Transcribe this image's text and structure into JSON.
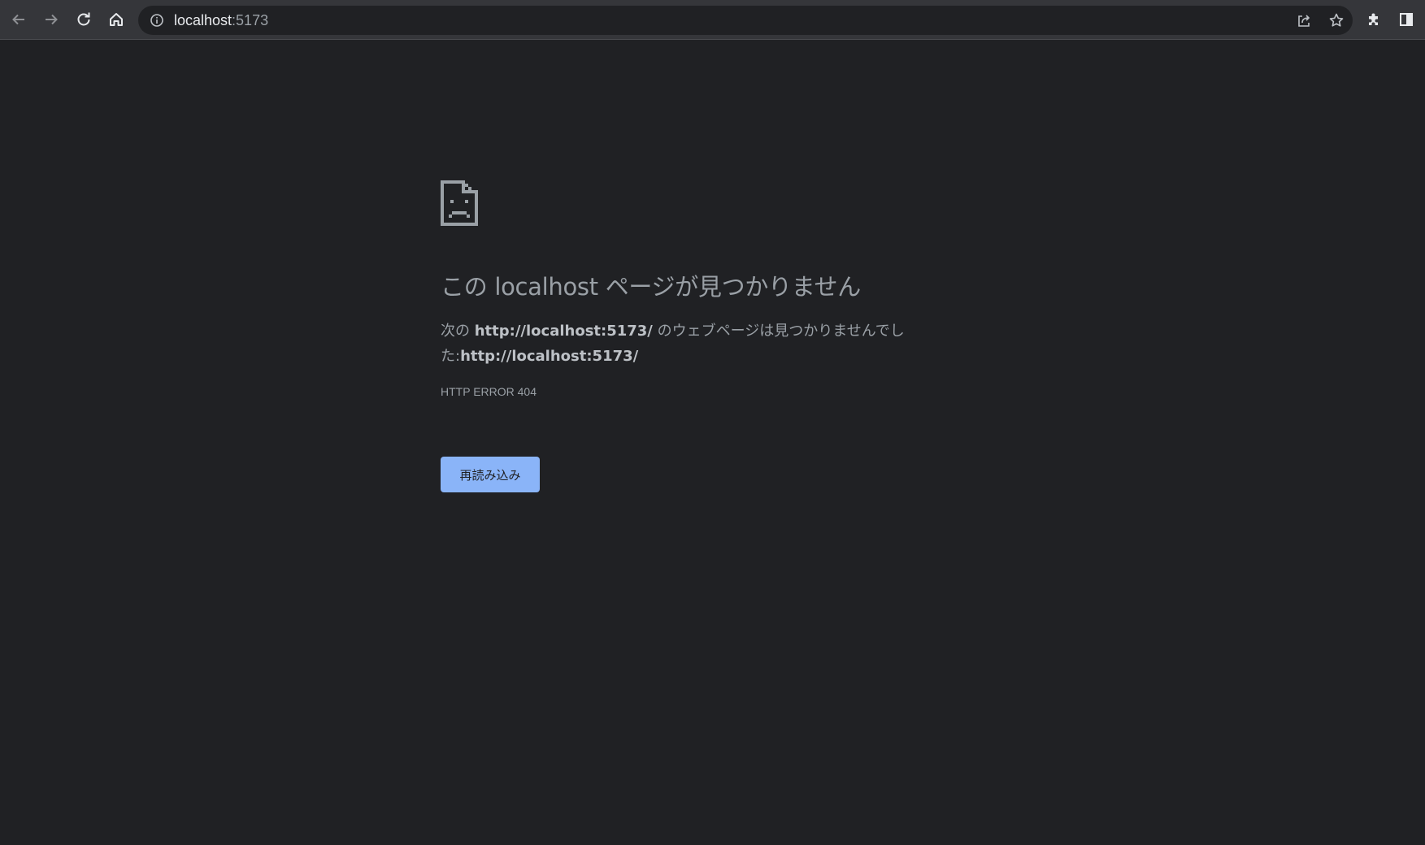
{
  "browser": {
    "url_host": "localhost",
    "url_port": ":5173",
    "back_icon": "arrow-left-icon",
    "forward_icon": "arrow-right-icon",
    "reload_icon": "reload-icon",
    "home_icon": "home-icon",
    "site_info_icon": "info-icon",
    "share_icon": "share-icon",
    "bookmark_icon": "star-icon",
    "extensions_icon": "puzzle-icon",
    "side_panel_icon": "side-panel-icon"
  },
  "error_page": {
    "icon": "sad-document-icon",
    "headline": "この localhost ページが見つかりません",
    "desc_prefix": "次の ",
    "desc_url": "http://localhost:5173/",
    "desc_middle": " のウェブページは見つかりませんでした:",
    "desc_url2": "http://localhost:5173/",
    "error_code": "HTTP ERROR 404",
    "reload_button": "再読み込み"
  },
  "colors": {
    "page_background": "#202124",
    "toolbar_background": "#35363a",
    "text_secondary": "#9aa0a6",
    "button_accent": "#8ab4f8"
  }
}
